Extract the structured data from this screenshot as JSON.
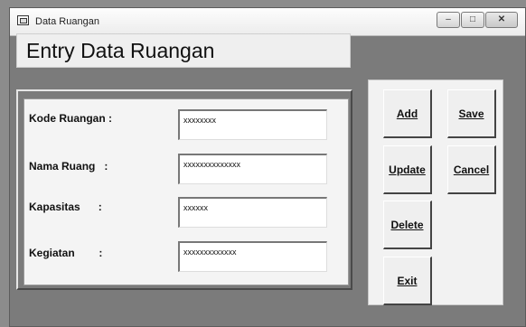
{
  "window": {
    "title": "Data Ruangan",
    "controls": {
      "minimize": "–",
      "maximize": "□",
      "close": "✕"
    }
  },
  "header": {
    "title": "Entry Data Ruangan"
  },
  "form": {
    "kode": {
      "label": "Kode Ruangan :",
      "value": "xxxxxxxx"
    },
    "nama": {
      "label": "Nama Ruang   :",
      "value": "xxxxxxxxxxxxxx"
    },
    "kapasitas": {
      "label": "Kapasitas      :",
      "value": "xxxxxx"
    },
    "kegiatan": {
      "label": "Kegiatan        :",
      "value": "xxxxxxxxxxxxx"
    }
  },
  "buttons": {
    "add": "Add",
    "save": "Save",
    "update": "Update",
    "cancel": "Cancel",
    "delete": "Delete",
    "exit": "Exit"
  }
}
